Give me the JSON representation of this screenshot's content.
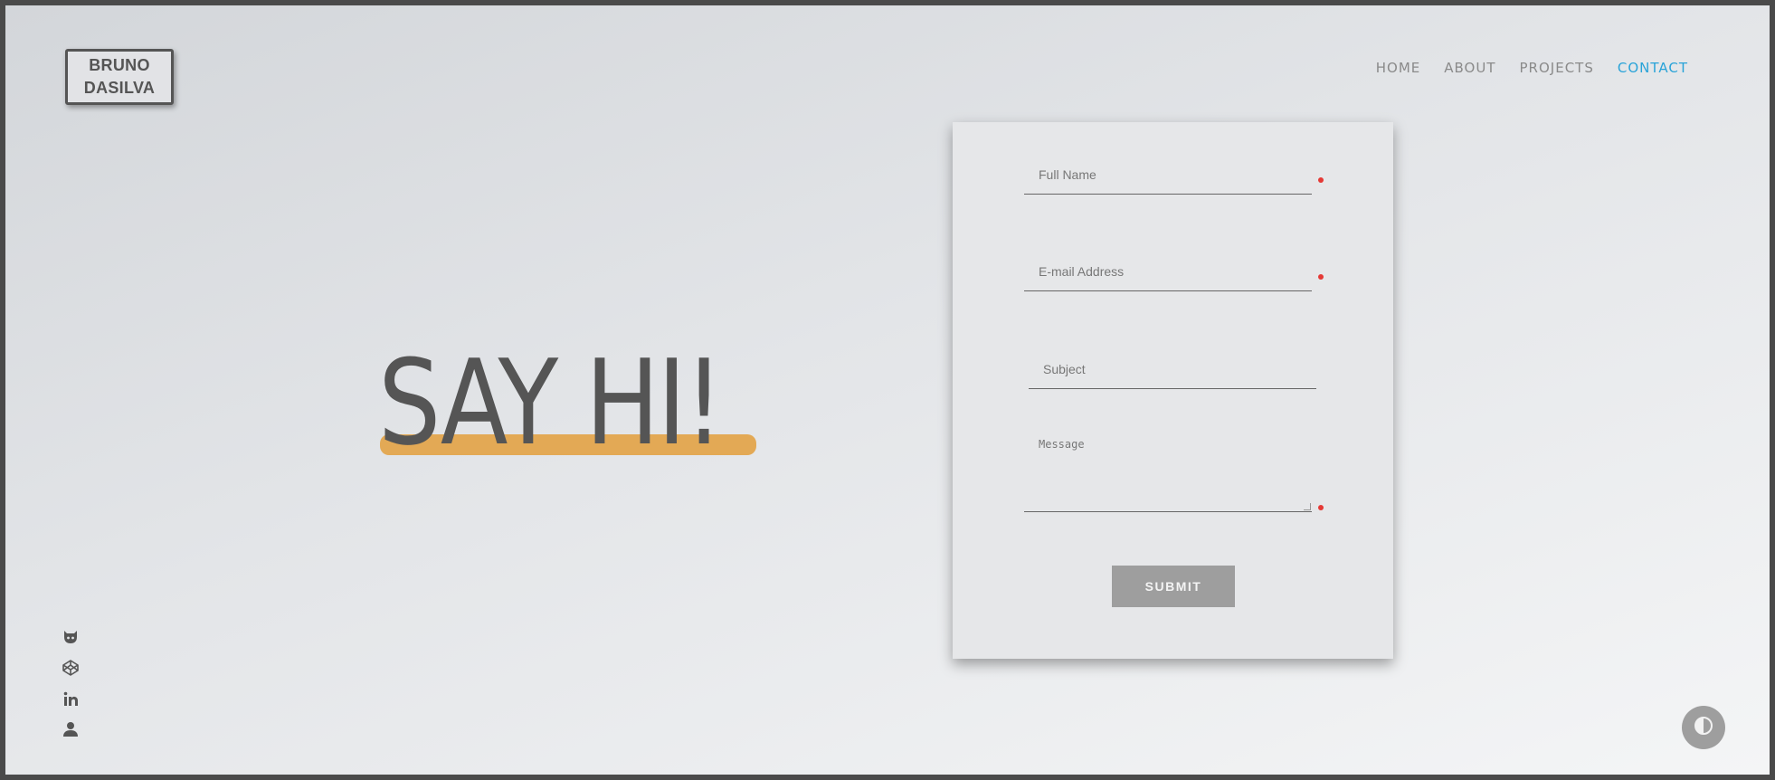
{
  "logo": {
    "line1": "BRUNO",
    "line2": "DASILVA"
  },
  "nav": {
    "items": [
      {
        "label": "HOME"
      },
      {
        "label": "ABOUT"
      },
      {
        "label": "PROJECTS"
      },
      {
        "label": "CONTACT"
      }
    ],
    "active": "CONTACT",
    "active_color": "#29a3d8"
  },
  "hero": {
    "title": "SAY HI!",
    "underline_color": "#e3a955"
  },
  "form": {
    "full_name": {
      "placeholder": "Full Name",
      "required": true
    },
    "email": {
      "placeholder": "E-mail Address",
      "required": true
    },
    "subject": {
      "placeholder": "Subject",
      "required": false
    },
    "message": {
      "placeholder": "Message",
      "required": true
    },
    "submit_label": "SUBMIT",
    "required_color": "#e53935"
  },
  "social": {
    "icons": [
      "github-icon",
      "codepen-icon",
      "linkedin-icon",
      "user-icon"
    ]
  },
  "theme_toggle": {
    "icon": "contrast-icon"
  }
}
